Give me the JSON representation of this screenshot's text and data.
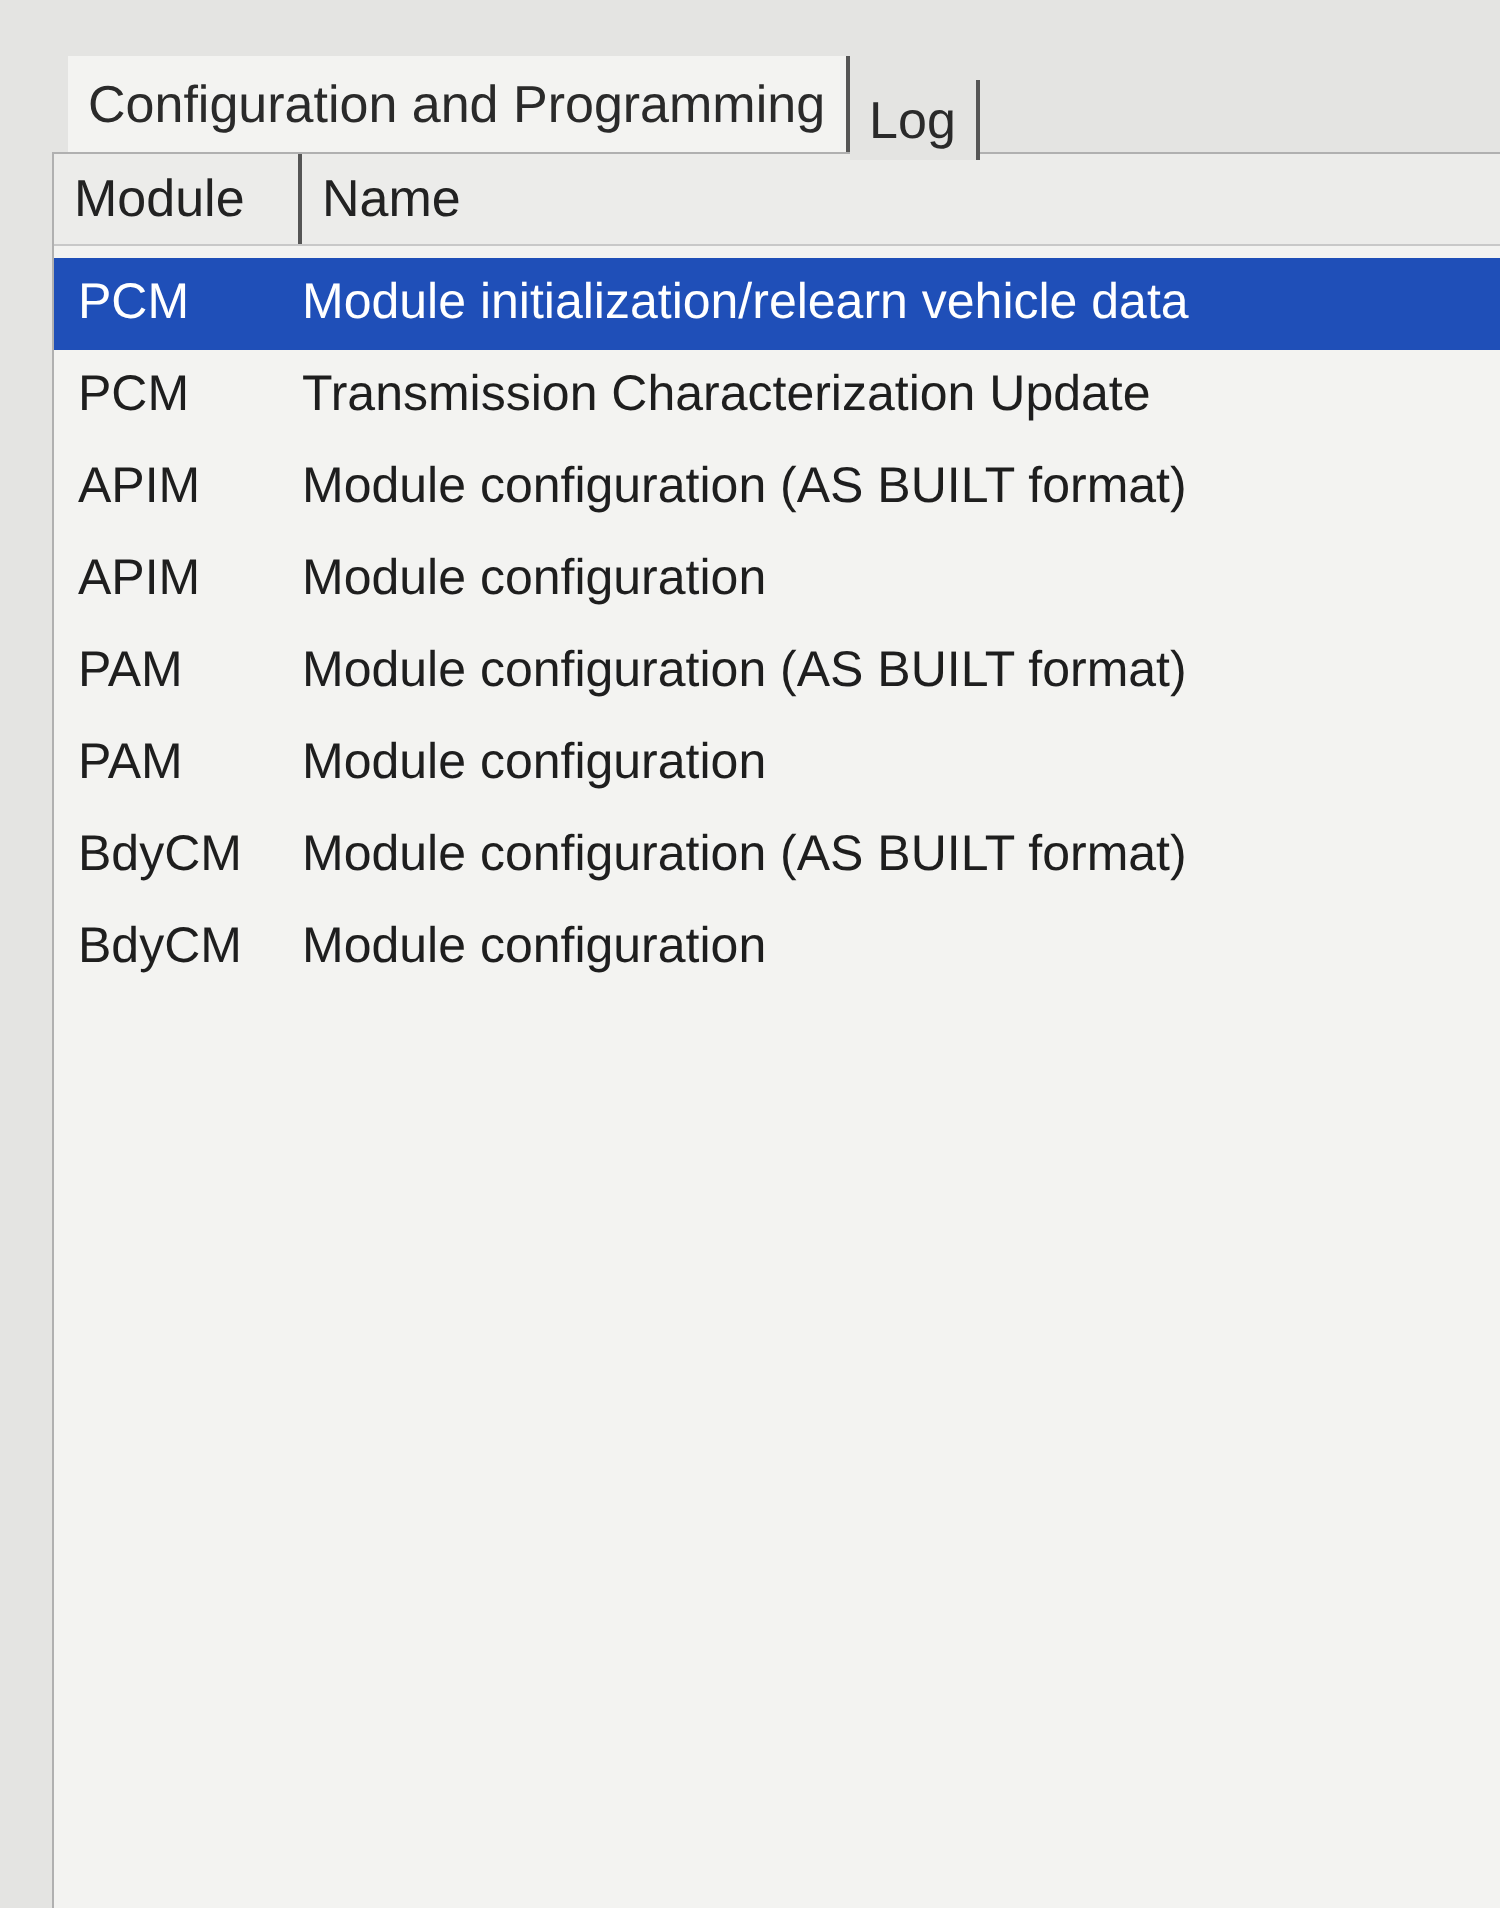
{
  "tabs": [
    {
      "label": "Configuration and Programming",
      "selected": true
    },
    {
      "label": "Log",
      "selected": false
    }
  ],
  "table": {
    "columns": [
      "Module",
      "Name"
    ],
    "rows": [
      {
        "module": "PCM",
        "name": "Module initialization/relearn vehicle data",
        "selected": true
      },
      {
        "module": "PCM",
        "name": "Transmission Characterization Update",
        "selected": false
      },
      {
        "module": "APIM",
        "name": "Module configuration (AS BUILT format)",
        "selected": false
      },
      {
        "module": "APIM",
        "name": "Module configuration",
        "selected": false
      },
      {
        "module": "PAM",
        "name": "Module configuration (AS BUILT format)",
        "selected": false
      },
      {
        "module": "PAM",
        "name": "Module configuration",
        "selected": false
      },
      {
        "module": "BdyCM",
        "name": "Module configuration (AS BUILT format)",
        "selected": false
      },
      {
        "module": "BdyCM",
        "name": "Module configuration",
        "selected": false
      }
    ]
  }
}
